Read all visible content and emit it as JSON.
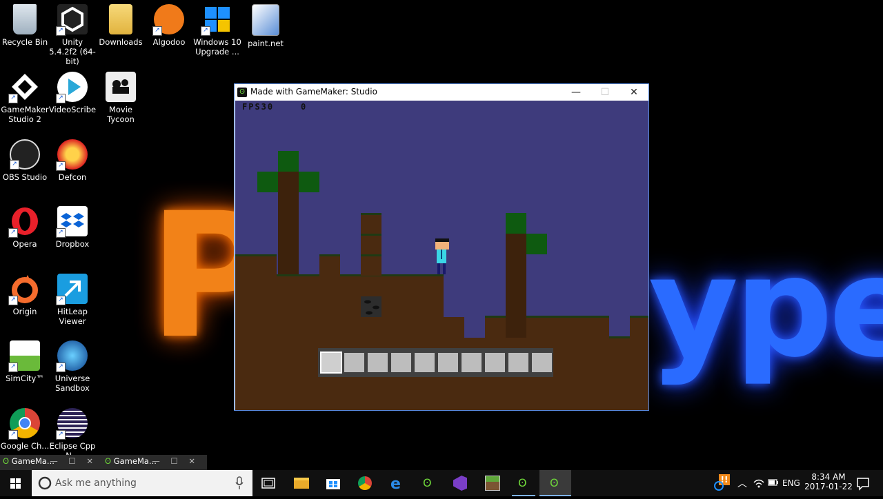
{
  "wallpaper": {
    "text_left": "P",
    "text_right": "ype"
  },
  "desktop_icons": [
    {
      "label": "Recycle Bin"
    },
    {
      "label": "Unity 5.4.2f2 (64-bit)"
    },
    {
      "label": "Downloads"
    },
    {
      "label": "Algodoo"
    },
    {
      "label": "Windows 10 Upgrade ..."
    },
    {
      "label": "paint.net"
    },
    {
      "label": "GameMaker Studio 2"
    },
    {
      "label": "VideoScribe"
    },
    {
      "label": "Movie Tycoon"
    },
    {
      "label": "OBS Studio"
    },
    {
      "label": "Defcon"
    },
    {
      "label": "Opera"
    },
    {
      "label": "Dropbox"
    },
    {
      "label": "Origin"
    },
    {
      "label": "HitLeap Viewer"
    },
    {
      "label": "SimCity™"
    },
    {
      "label": "Universe Sandbox"
    },
    {
      "label": "Google Ch..."
    },
    {
      "label": "Eclipse Cpp N..."
    }
  ],
  "window": {
    "title": "Made with GameMaker: Studio",
    "minimize": "—",
    "maximize": "☐",
    "close": "✕",
    "hud": {
      "fps_label": "FPS30",
      "score": "0"
    }
  },
  "thumbnails": [
    {
      "label": "GameMa..."
    },
    {
      "label": "GameMa..."
    }
  ],
  "taskbar": {
    "search_placeholder": "Ask me anything",
    "language": "ENG",
    "time": "8:34 AM",
    "date": "2017-01-22"
  }
}
